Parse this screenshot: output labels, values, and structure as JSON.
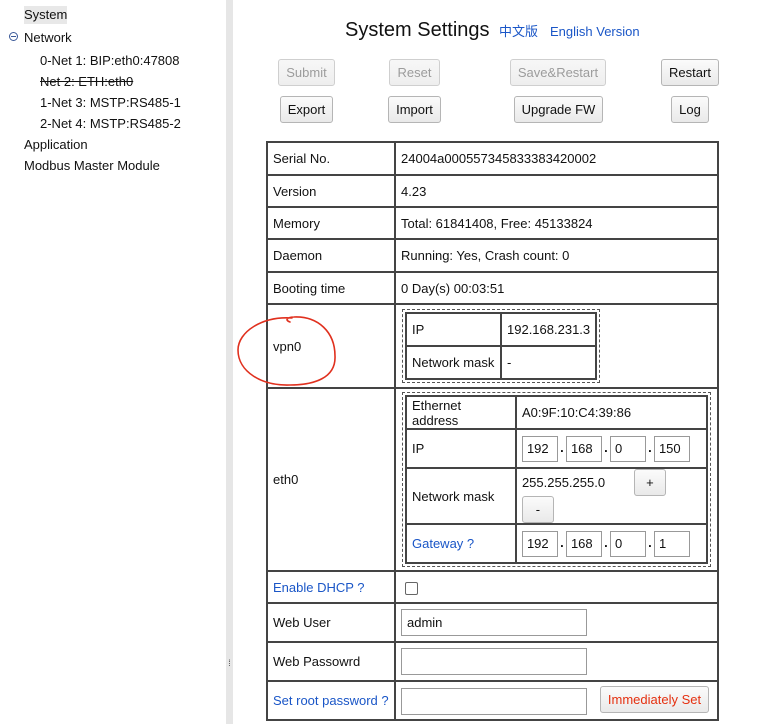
{
  "tree": {
    "items": [
      {
        "label": "System"
      },
      {
        "label": "Network"
      },
      {
        "label": "0-Net 1: BIP:eth0:47808"
      },
      {
        "label": "Net 2: ETH:eth0"
      },
      {
        "label": "1-Net 3: MSTP:RS485-1"
      },
      {
        "label": "2-Net 4: MSTP:RS485-2"
      },
      {
        "label": "Application"
      },
      {
        "label": "Modbus Master Module"
      }
    ],
    "splitter_grip": "⁞"
  },
  "header": {
    "title": "System Settings",
    "lang_cn": "中文版",
    "lang_en": "English Version"
  },
  "toolbar": {
    "submit": "Submit",
    "reset": "Reset",
    "save_restart": "Save&Restart",
    "restart": "Restart",
    "export": "Export",
    "import": "Import",
    "upgrade_fw": "Upgrade FW",
    "log": "Log"
  },
  "info": {
    "serial_label": "Serial No.",
    "serial_value": "24004a000557345833383420002",
    "version_label": "Version",
    "version_value": "4.23",
    "memory_label": "Memory",
    "memory_value": "Total: 61841408, Free: 45133824",
    "daemon_label": "Daemon",
    "daemon_value": "Running: Yes, Crash count: 0",
    "booting_label": "Booting time",
    "booting_value": "0 Day(s) 00:03:51"
  },
  "vpn0": {
    "label": "vpn0",
    "ip_label": "IP",
    "ip_value": "192.168.231.3",
    "mask_label": "Network mask",
    "mask_value": "-"
  },
  "eth0": {
    "label": "eth0",
    "mac_label": "Ethernet address",
    "mac_value": "A0:9F:10:C4:39:86",
    "ip_label": "IP",
    "ip": [
      "192",
      "168",
      "0",
      "150"
    ],
    "mask_label": "Network mask",
    "mask_value": "255.255.255.0",
    "plus": "+",
    "minus": "-",
    "gateway_label": "Gateway ?",
    "gateway": [
      "192",
      "168",
      "0",
      "1"
    ]
  },
  "dhcp": {
    "label": "Enable DHCP ?"
  },
  "web_user": {
    "label": "Web User",
    "value": "admin"
  },
  "web_password": {
    "label": "Web Passowrd",
    "value": ""
  },
  "root_password": {
    "label": "Set root password ?",
    "value": "",
    "button": "Immediately Set"
  },
  "colors": {
    "link": "#1a56c7",
    "warn": "#e53010",
    "annotation": "#e0301e"
  }
}
